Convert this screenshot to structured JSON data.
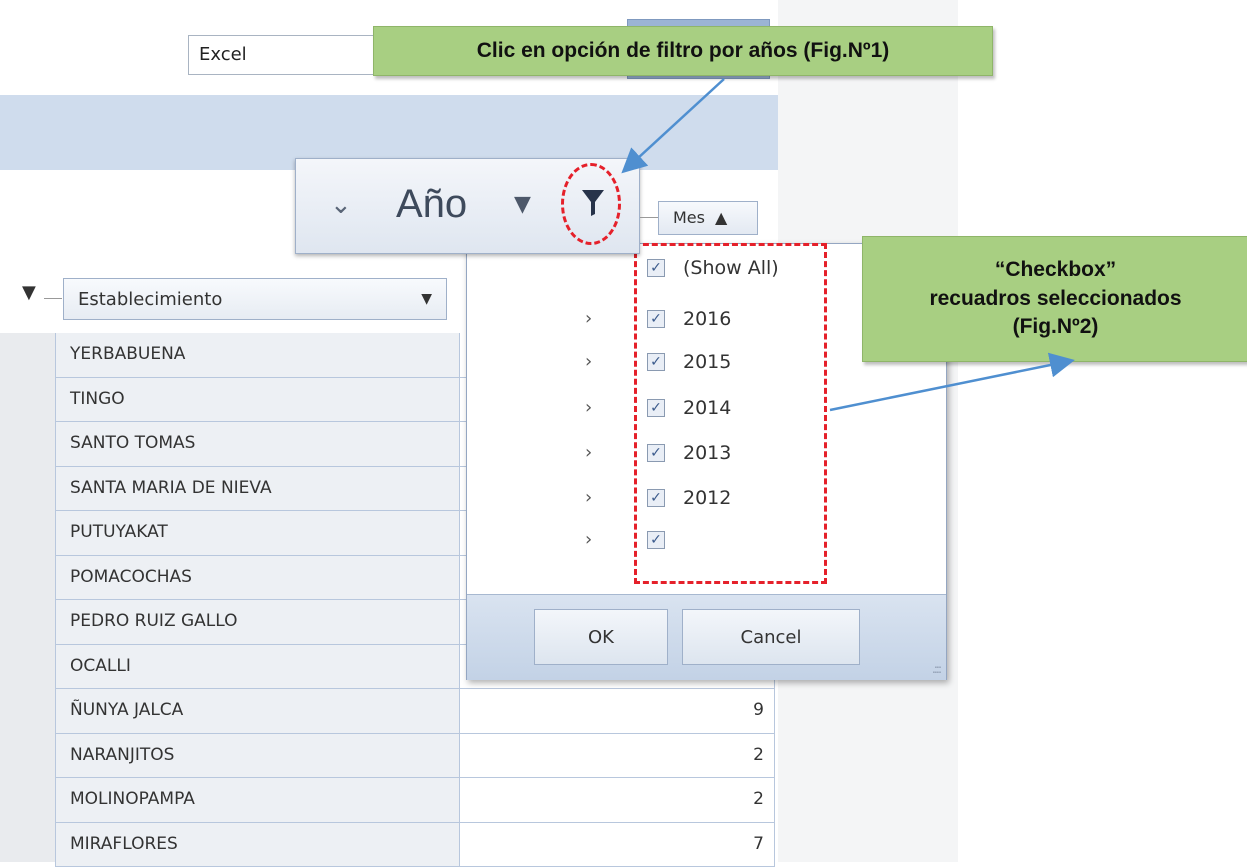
{
  "toolbar": {
    "export_format": "Excel"
  },
  "annotations": {
    "fig1_text": "Clic en opción de filtro por años (Fig.Nº1)",
    "fig2_line1": "“Checkbox”",
    "fig2_line2": "recuadros seleccionados",
    "fig2_line3": "(Fig.Nº2)",
    "highlight_color": "#e5202a",
    "callout_color": "#a8cf82"
  },
  "pivot": {
    "year_field": "Año",
    "month_field": "Mes",
    "establishment_field": "Establecimiento",
    "icons": {
      "expand": "chevron-down-icon",
      "sort": "sort-desc-icon",
      "filter": "funnel-icon",
      "month_sort": "sort-asc-icon"
    }
  },
  "rows": [
    {
      "name": "YERBABUENA",
      "value": ""
    },
    {
      "name": "TINGO",
      "value": ""
    },
    {
      "name": "SANTO TOMAS",
      "value": ""
    },
    {
      "name": "SANTA MARIA DE NIEVA",
      "value": ""
    },
    {
      "name": "PUTUYAKAT",
      "value": ""
    },
    {
      "name": "POMACOCHAS",
      "value": ""
    },
    {
      "name": "PEDRO RUIZ GALLO",
      "value": ""
    },
    {
      "name": "OCALLI",
      "value": ""
    },
    {
      "name": "ÑUNYA JALCA",
      "value": "9"
    },
    {
      "name": "NARANJITOS",
      "value": "2"
    },
    {
      "name": "MOLINOPAMPA",
      "value": "2"
    },
    {
      "name": "MIRAFLORES",
      "value": "7"
    }
  ],
  "filter_popup": {
    "items": [
      {
        "label": "(Show All)",
        "checked": true,
        "expandable": false
      },
      {
        "label": "2016",
        "checked": true,
        "expandable": true
      },
      {
        "label": "2015",
        "checked": true,
        "expandable": true
      },
      {
        "label": "2014",
        "checked": true,
        "expandable": true
      },
      {
        "label": "2013",
        "checked": true,
        "expandable": true
      },
      {
        "label": "2012",
        "checked": true,
        "expandable": true
      },
      {
        "label": "",
        "checked": true,
        "expandable": true
      }
    ],
    "ok_label": "OK",
    "cancel_label": "Cancel"
  }
}
